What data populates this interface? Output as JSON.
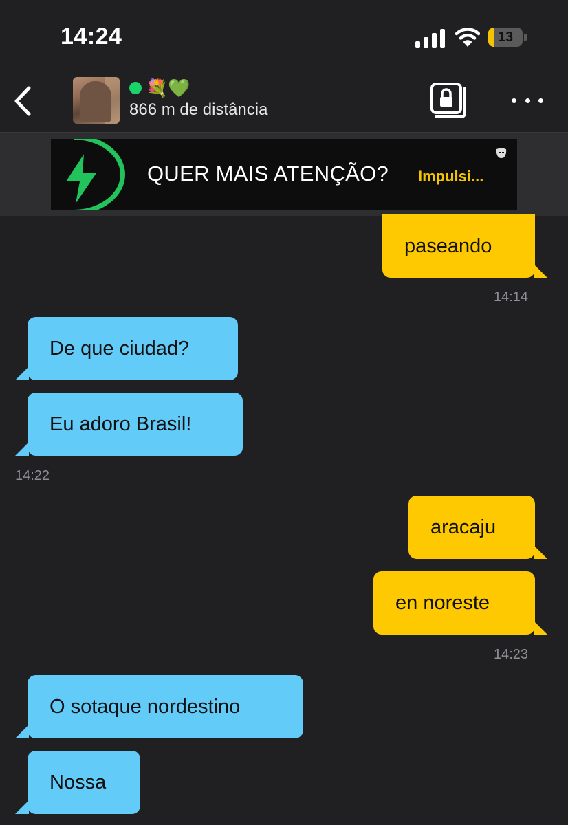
{
  "status_bar": {
    "time": "14:24",
    "battery": "13",
    "battery_level_percent": 13
  },
  "header": {
    "status_emojis": "💐💚",
    "distance": "866 m de distância",
    "icons": {
      "back": "chevron-left-icon",
      "album": "private-album-lock-icon",
      "more": "ellipsis-icon"
    }
  },
  "promo": {
    "text": "QUER MAIS ATENÇÃO?",
    "cta": "Impulsi...",
    "colors": {
      "bolt": "#22c35a",
      "cta": "#f5c400"
    }
  },
  "messages": [
    {
      "direction": "out",
      "text": "paseando"
    },
    {
      "direction": "in",
      "text": "De que ciudad?"
    },
    {
      "direction": "in",
      "text": "Eu adoro Brasil!"
    },
    {
      "direction": "out",
      "text": "aracaju"
    },
    {
      "direction": "out",
      "text": "en noreste"
    },
    {
      "direction": "in",
      "text": "O sotaque nordestino"
    },
    {
      "direction": "in",
      "text": "Nossa"
    }
  ],
  "timestamps": [
    "14:14",
    "14:22",
    "14:23"
  ],
  "colors": {
    "background": "#202022",
    "outgoing_bubble": "#fec900",
    "incoming_bubble": "#62cbf7",
    "online": "#19d36b"
  }
}
